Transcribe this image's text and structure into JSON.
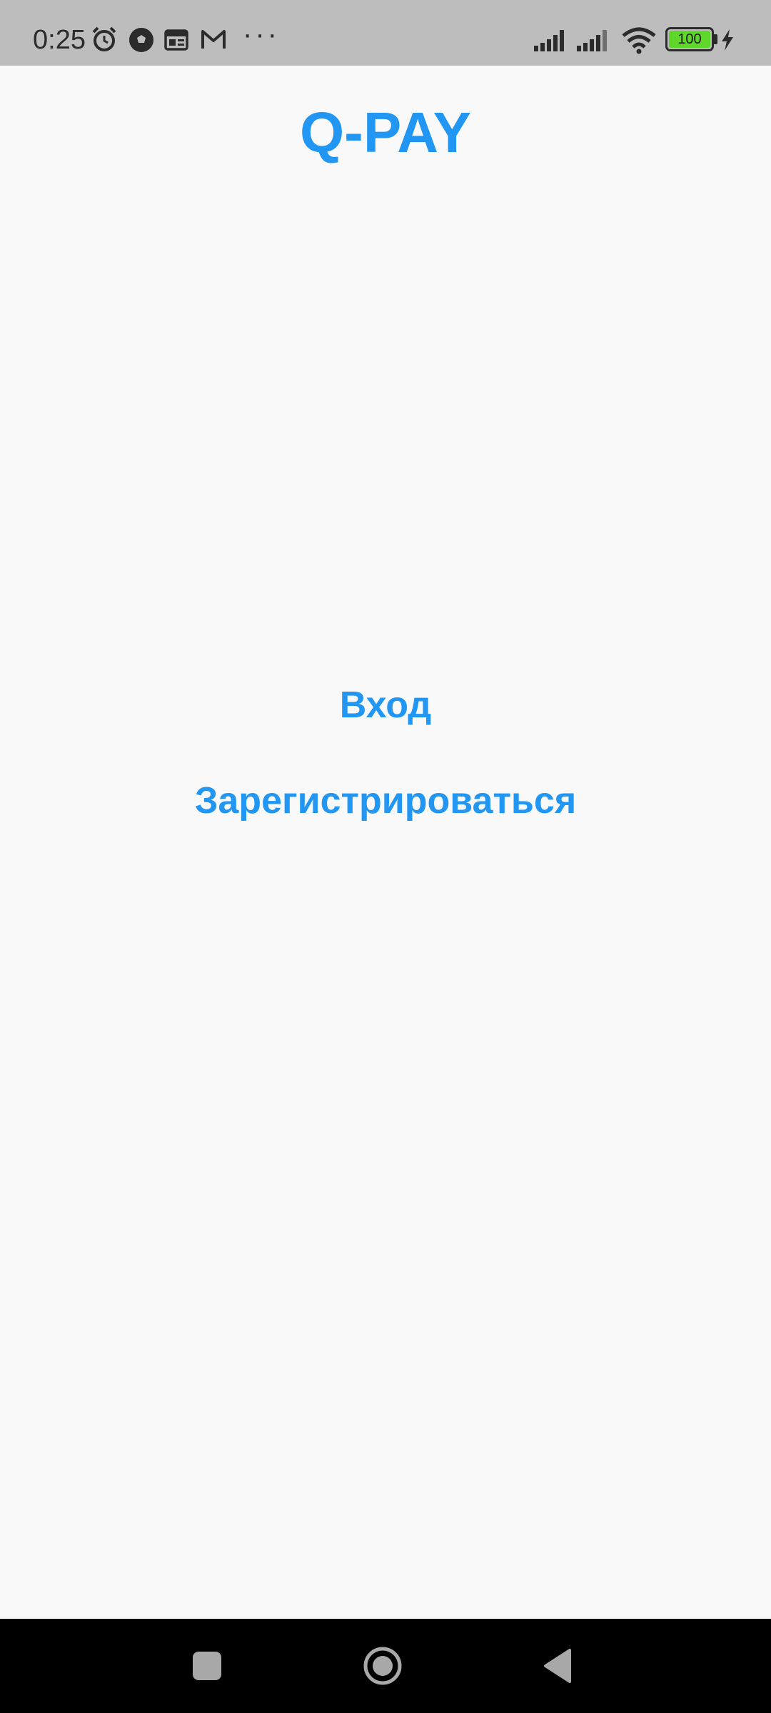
{
  "status_bar": {
    "time": "0:25",
    "battery_level": "100",
    "icons": [
      "alarm-icon",
      "soccer-ball-icon",
      "news-icon",
      "gmail-icon",
      "more-dots-icon",
      "signal-icon",
      "signal-icon",
      "wifi-icon",
      "battery-icon",
      "charging-icon"
    ],
    "dots": "···"
  },
  "app": {
    "title": "Q-PAY",
    "login_label": "Вход",
    "register_label": "Зарегистрироваться"
  },
  "colors": {
    "accent": "#2196f3",
    "background": "#f9f9f9",
    "status_bar": "#bdbdbd",
    "nav_bar": "#000000",
    "battery_fill": "#5ed62a"
  },
  "nav_bar": {
    "buttons": [
      "recent-apps-icon",
      "home-icon",
      "back-icon"
    ]
  }
}
